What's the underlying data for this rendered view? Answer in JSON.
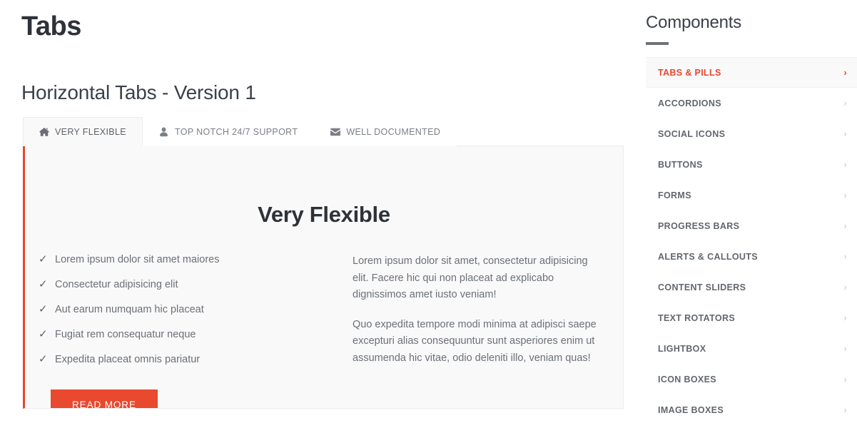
{
  "page": {
    "title": "Tabs",
    "section_title": "Horizontal Tabs - Version 1"
  },
  "tabs": {
    "items": [
      {
        "label": "VERY FLEXIBLE",
        "icon": "home-icon",
        "active": true
      },
      {
        "label": "TOP NOTCH 24/7 SUPPORT",
        "icon": "user-icon",
        "active": false
      },
      {
        "label": "WELL DOCUMENTED",
        "icon": "envelope-icon",
        "active": false
      }
    ],
    "panel": {
      "heading": "Very Flexible",
      "checklist": [
        "Lorem ipsum dolor sit amet maiores",
        "Consectetur adipisicing elit",
        "Aut earum numquam hic placeat",
        "Fugiat rem consequatur neque",
        "Expedita placeat omnis pariatur"
      ],
      "check_glyph": "✓",
      "button_label": "READ MORE",
      "paragraphs": [
        "Lorem ipsum dolor sit amet, consectetur adipisicing elit. Facere hic qui non placeat ad explicabo dignissimos amet iusto veniam!",
        "Quo expedita tempore modi minima at adipisci saepe excepturi alias consequuntur sunt asperiores enim ut assumenda hic vitae, odio deleniti illo, veniam quas!"
      ]
    }
  },
  "sidebar": {
    "title": "Components",
    "chevron_glyph": "›",
    "items": [
      {
        "label": "TABS & PILLS",
        "active": true
      },
      {
        "label": "ACCORDIONS",
        "active": false
      },
      {
        "label": "SOCIAL ICONS",
        "active": false
      },
      {
        "label": "BUTTONS",
        "active": false
      },
      {
        "label": "FORMS",
        "active": false
      },
      {
        "label": "PROGRESS BARS",
        "active": false
      },
      {
        "label": "ALERTS & CALLOUTS",
        "active": false
      },
      {
        "label": "CONTENT SLIDERS",
        "active": false
      },
      {
        "label": "TEXT ROTATORS",
        "active": false
      },
      {
        "label": "LIGHTBOX",
        "active": false
      },
      {
        "label": "ICON BOXES",
        "active": false
      },
      {
        "label": "IMAGE BOXES",
        "active": false
      }
    ]
  },
  "colors": {
    "accent": "#e8462f",
    "panel_bg": "#f9f9f9",
    "text": "#6b7077",
    "heading": "#2e3238"
  }
}
